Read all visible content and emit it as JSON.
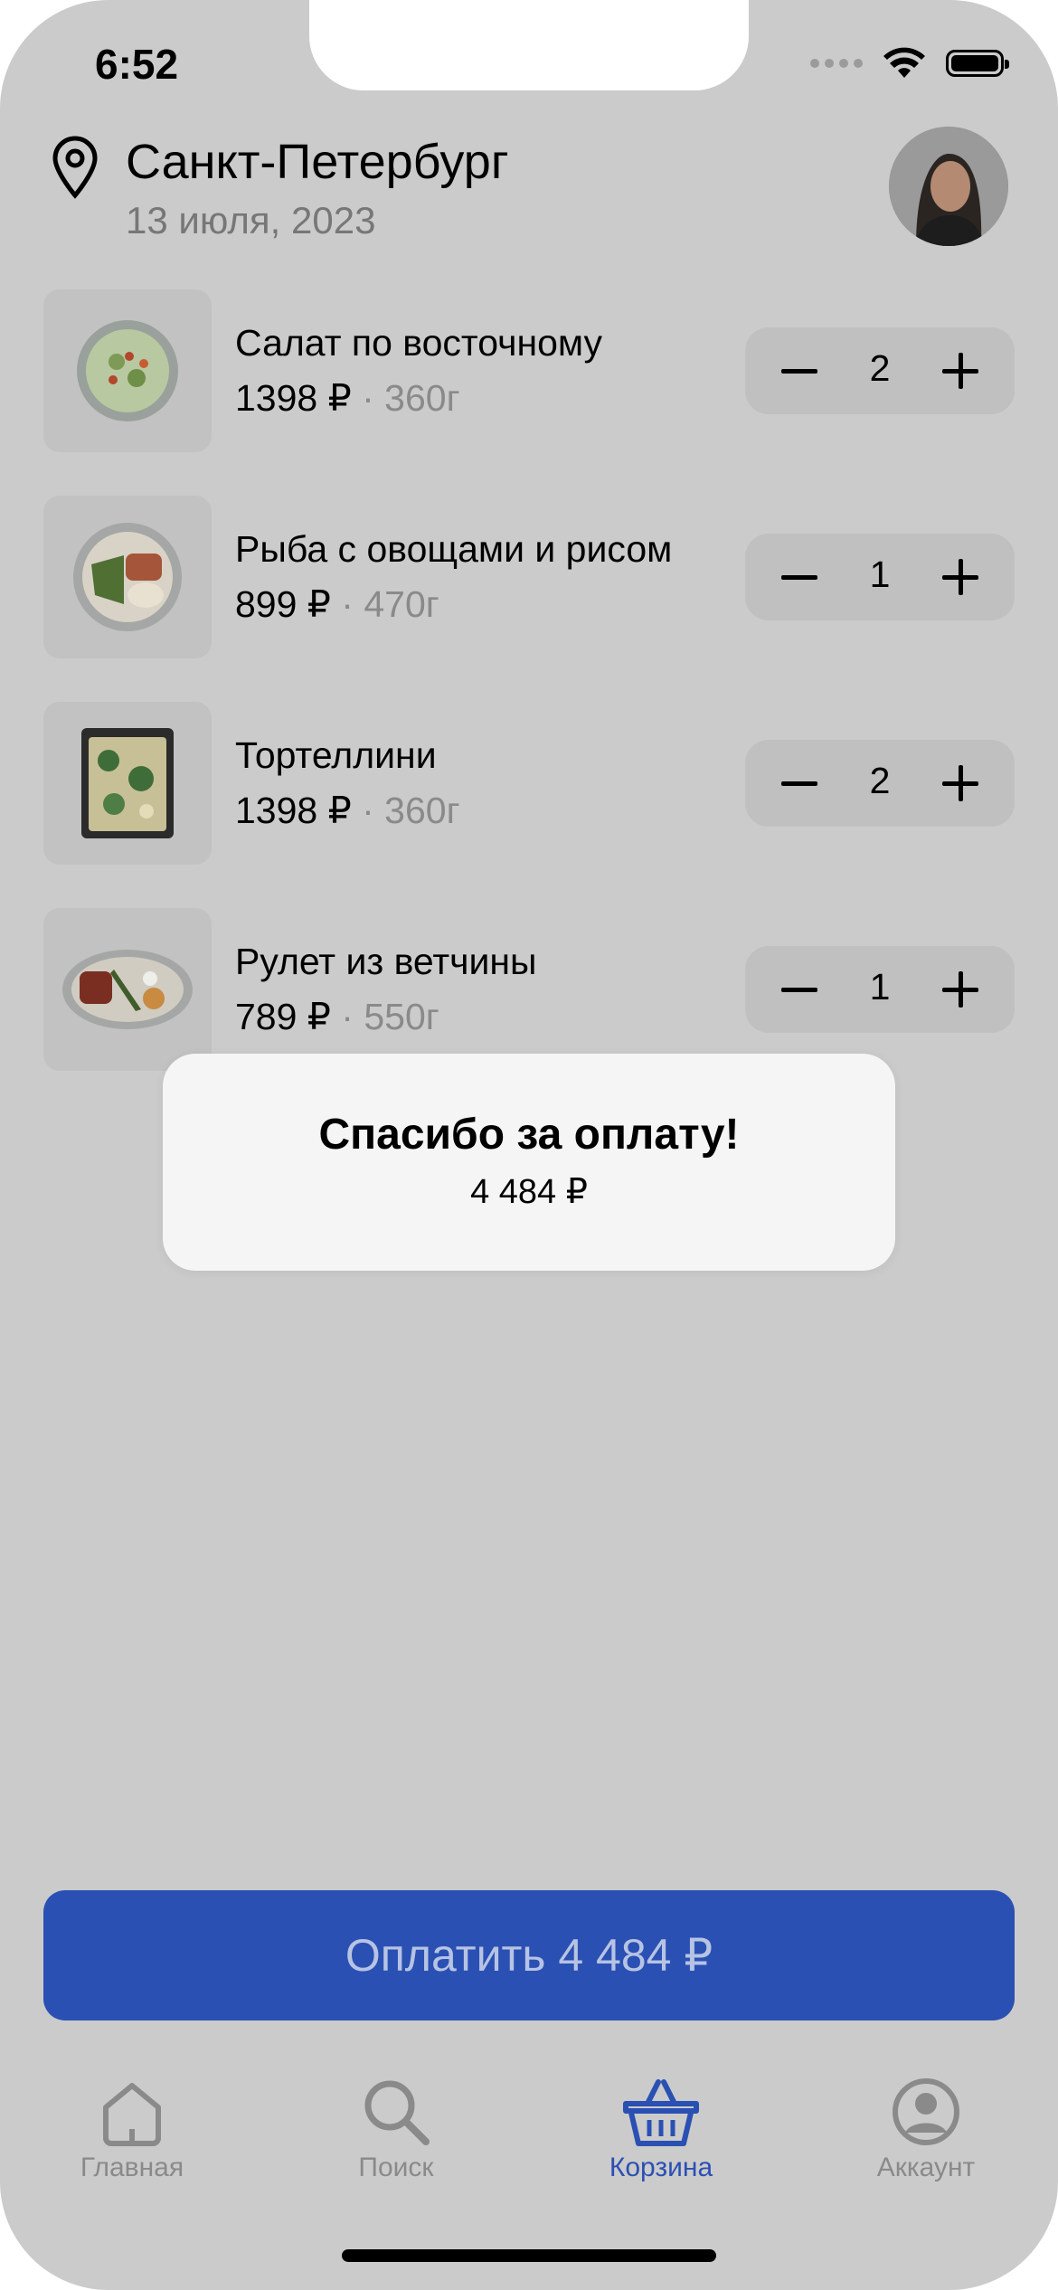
{
  "status_bar": {
    "time": "6:52",
    "icons": [
      "signal-icon",
      "wifi-icon",
      "battery-icon"
    ]
  },
  "header": {
    "location_icon": "map-pin-icon",
    "city": "Санкт-Петербург",
    "date": "13 июля, 2023",
    "avatar": "user-photo-avatar"
  },
  "cart": {
    "items": [
      {
        "name": "Салат по восточному",
        "price": "1398 ₽",
        "separator": "·",
        "weight": "360г",
        "quantity": "2",
        "image": "salad-plate"
      },
      {
        "name": "Рыба с овощами и рисом",
        "price": "899 ₽",
        "separator": "·",
        "weight": "470г",
        "quantity": "1",
        "image": "fish-rice-plate"
      },
      {
        "name": "Тортеллини",
        "price": "1398 ₽",
        "separator": "·",
        "weight": "360г",
        "quantity": "2",
        "image": "tortellini-tray"
      },
      {
        "name": "Рулет из ветчины",
        "price": "789 ₽",
        "separator": "·",
        "weight": "550г",
        "quantity": "1",
        "image": "ham-roll-plate"
      }
    ]
  },
  "toast": {
    "title": "Спасибо за оплату!",
    "amount": "4 484 ₽"
  },
  "pay_button": {
    "label": "Оплатить 4 484 ₽"
  },
  "tabbar": {
    "tabs": [
      {
        "label": "Главная",
        "icon": "home-icon",
        "active": false
      },
      {
        "label": "Поиск",
        "icon": "search-icon",
        "active": false
      },
      {
        "label": "Корзина",
        "icon": "basket-icon",
        "active": true
      },
      {
        "label": "Аккаунт",
        "icon": "account-icon",
        "active": false
      }
    ]
  },
  "colors": {
    "background": "#cbcbcb",
    "accent": "#2a50b3",
    "toast": "#f5f5f5"
  }
}
